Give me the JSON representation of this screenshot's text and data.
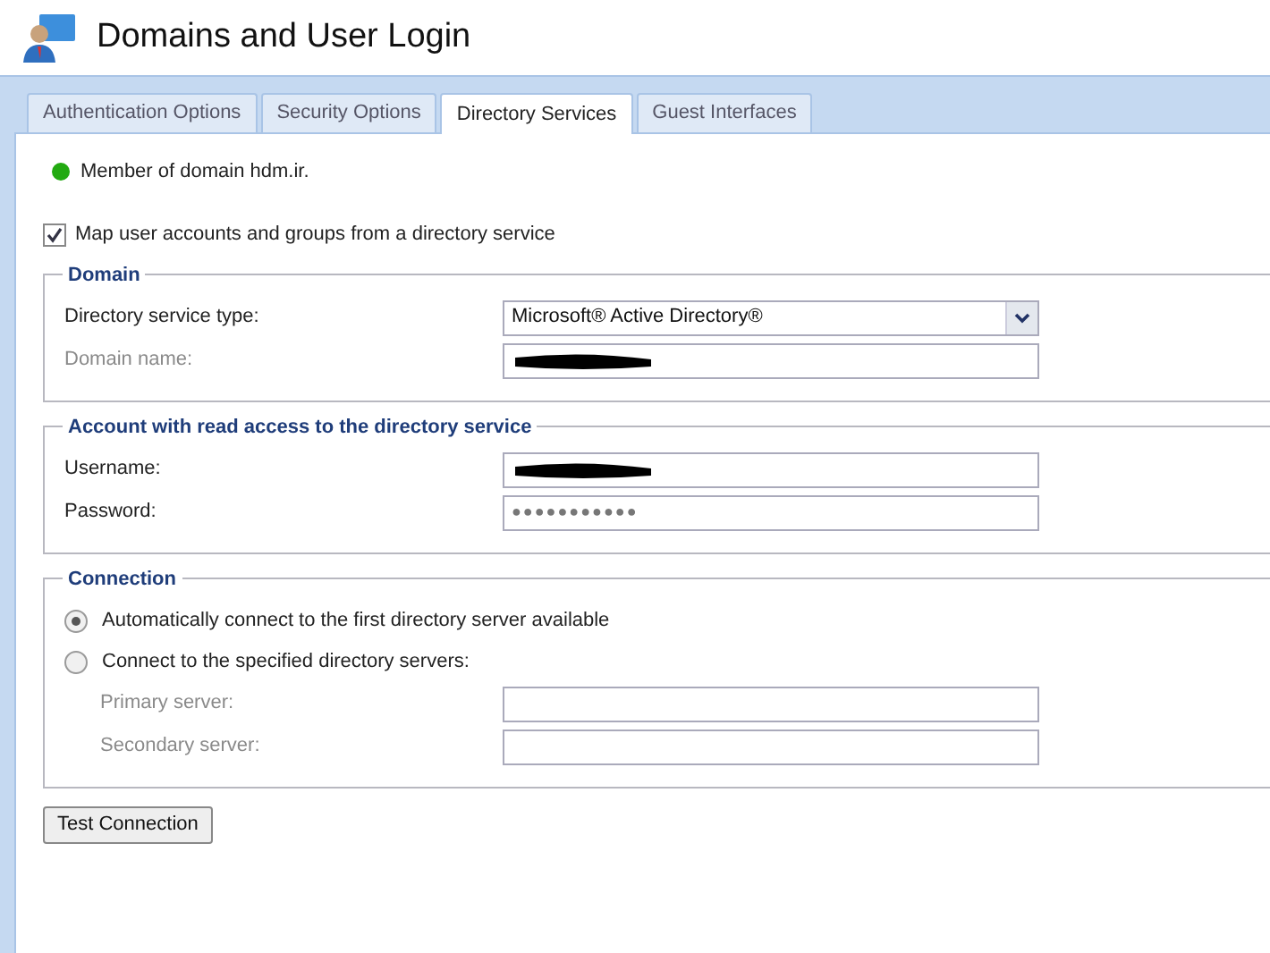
{
  "window": {
    "title": "Domains and User Login"
  },
  "tabs": [
    {
      "label": "Authentication Options",
      "selected": false
    },
    {
      "label": "Security Options",
      "selected": false
    },
    {
      "label": "Directory Services",
      "selected": true
    },
    {
      "label": "Guest Interfaces",
      "selected": false
    }
  ],
  "status": {
    "text": "Member of domain hdm.ir.",
    "color": "#22aa11"
  },
  "map_accounts": {
    "label": "Map user accounts and groups from a directory service",
    "checked": true
  },
  "sections": [
    {
      "title": "Domain",
      "rows": [
        {
          "kind": "select",
          "label": "Directory service type:",
          "value": "Microsoft® Active Directory®",
          "disabled": false
        },
        {
          "kind": "text",
          "label": "Domain name:",
          "redacted": true,
          "disabled": true
        }
      ]
    },
    {
      "title": "Account with read access to the directory service",
      "rows": [
        {
          "kind": "text",
          "label": "Username:",
          "redacted": true,
          "disabled": false
        },
        {
          "kind": "password",
          "label": "Password:",
          "value": "●●●●●●●●●●●",
          "disabled": false
        }
      ]
    },
    {
      "title": "Connection",
      "rows": [
        {
          "kind": "radio",
          "label": "Automatically connect to the first directory server available",
          "selected": true
        },
        {
          "kind": "radio",
          "label": "Connect to the specified directory servers:",
          "selected": false
        },
        {
          "kind": "text",
          "label": "Primary server:",
          "disabled": true,
          "indent": true
        },
        {
          "kind": "text",
          "label": "Secondary server:",
          "disabled": true,
          "indent": true
        }
      ]
    }
  ],
  "buttons": [
    {
      "label": "Test Connection"
    }
  ]
}
